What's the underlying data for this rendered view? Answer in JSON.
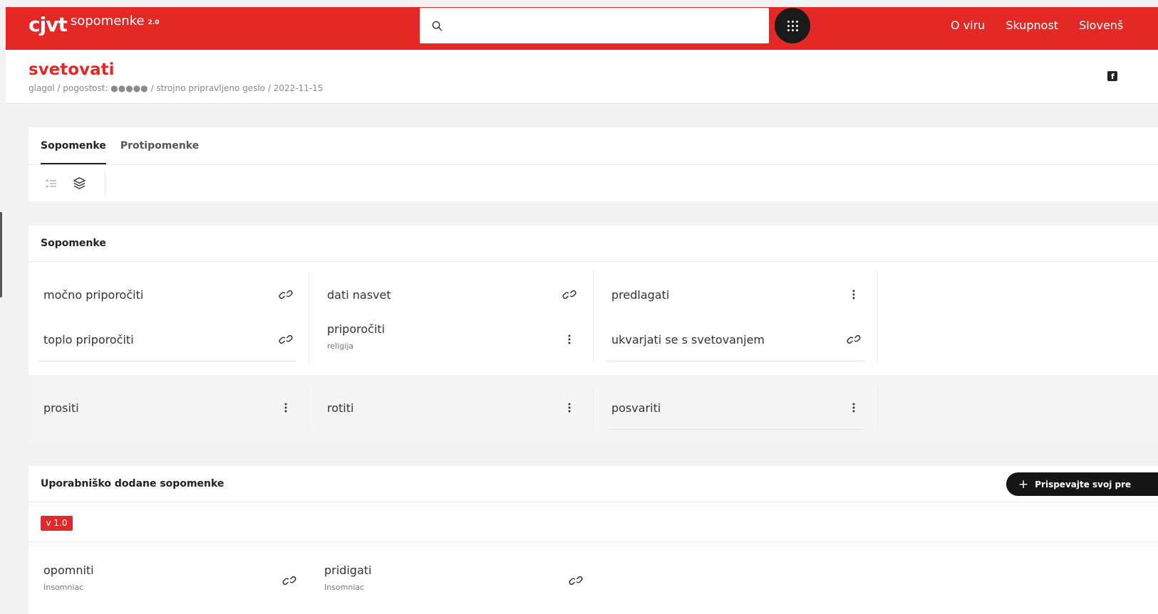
{
  "header": {
    "logo_mark": "cjvt",
    "logo_name": "sopomenke",
    "logo_version": "2.0",
    "search_placeholder": "",
    "nav": [
      "O viru",
      "Skupnost",
      "Slovenš"
    ]
  },
  "entry": {
    "headword": "svetovati",
    "meta": "glagol / pogostost: ●●●●● / strojno pripravljeno geslo / 2022-11-15"
  },
  "tabs": [
    "Sopomenke",
    "Protipomenke"
  ],
  "synonyms": {
    "title": "Sopomenke",
    "rows": [
      [
        {
          "text": "močno priporočiti",
          "sub": "",
          "action": "link-icon"
        },
        {
          "text": "dati nasvet",
          "sub": "",
          "action": "link-icon"
        },
        {
          "text": "predlagati",
          "sub": "",
          "action": "more-icon"
        }
      ],
      [
        {
          "text": "toplo priporočiti",
          "sub": "",
          "action": "link-icon"
        },
        {
          "text": "priporočiti",
          "sub": "religija",
          "action": "more-icon"
        },
        {
          "text": "ukvarjati se s svetovanjem",
          "sub": "",
          "action": "link-icon"
        }
      ],
      [
        {
          "text": "prositi",
          "sub": "",
          "action": "more-icon"
        },
        {
          "text": "rotiti",
          "sub": "",
          "action": "more-icon"
        },
        {
          "text": "posvariti",
          "sub": "",
          "action": "more-icon"
        }
      ]
    ]
  },
  "user_synonyms": {
    "title": "Uporabniško dodane sopomenke",
    "contribute_label": "Prispevajte svoj pre",
    "version_badge": "v 1.0",
    "items": [
      {
        "text": "opomniti",
        "sub": "Insomniac",
        "action": "link-icon"
      },
      {
        "text": "pridigati",
        "sub": "Insomniac",
        "action": "link-icon"
      }
    ]
  },
  "colors": {
    "brand": "#e32826",
    "dark": "#161616"
  }
}
